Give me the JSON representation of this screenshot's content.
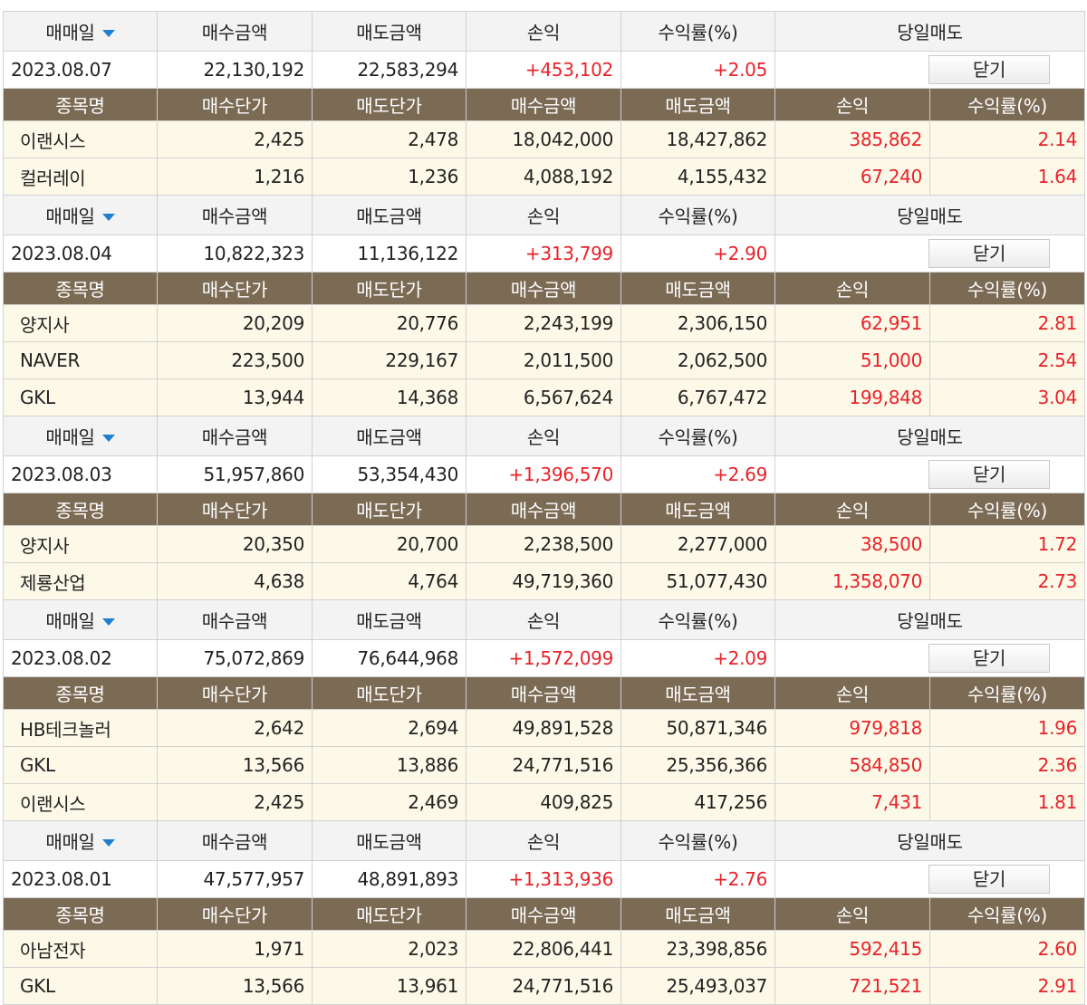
{
  "summary_headers": [
    "매매일",
    "매수금액",
    "매도금액",
    "손익",
    "수익률(%)",
    "당일매도"
  ],
  "detail_headers": [
    "종목명",
    "매수단가",
    "매도단가",
    "매수금액",
    "매도금액",
    "손익",
    "수익률(%)"
  ],
  "close_label": "닫기",
  "icons": {
    "sort": "sort-down-icon"
  },
  "colors": {
    "header_bg": "#7b6b55",
    "positive": "#e8222a",
    "detail_tint": "#fdf9e8",
    "sort_arrow": "#1e7fd0"
  },
  "groups": [
    {
      "date": "2023.08.07",
      "buy": "22,130,192",
      "sell": "22,583,294",
      "pnl": "+453,102",
      "rate": "+2.05",
      "items": [
        {
          "name": "이랜시스",
          "buy_price": "2,425",
          "sell_price": "2,478",
          "buy_amount": "18,042,000",
          "sell_amount": "18,427,862",
          "pnl": "385,862",
          "rate": "2.14"
        },
        {
          "name": "컬러레이",
          "buy_price": "1,216",
          "sell_price": "1,236",
          "buy_amount": "4,088,192",
          "sell_amount": "4,155,432",
          "pnl": "67,240",
          "rate": "1.64"
        }
      ]
    },
    {
      "date": "2023.08.04",
      "buy": "10,822,323",
      "sell": "11,136,122",
      "pnl": "+313,799",
      "rate": "+2.90",
      "items": [
        {
          "name": "양지사",
          "buy_price": "20,209",
          "sell_price": "20,776",
          "buy_amount": "2,243,199",
          "sell_amount": "2,306,150",
          "pnl": "62,951",
          "rate": "2.81"
        },
        {
          "name": "NAVER",
          "buy_price": "223,500",
          "sell_price": "229,167",
          "buy_amount": "2,011,500",
          "sell_amount": "2,062,500",
          "pnl": "51,000",
          "rate": "2.54"
        },
        {
          "name": "GKL",
          "buy_price": "13,944",
          "sell_price": "14,368",
          "buy_amount": "6,567,624",
          "sell_amount": "6,767,472",
          "pnl": "199,848",
          "rate": "3.04"
        }
      ]
    },
    {
      "date": "2023.08.03",
      "buy": "51,957,860",
      "sell": "53,354,430",
      "pnl": "+1,396,570",
      "rate": "+2.69",
      "items": [
        {
          "name": "양지사",
          "buy_price": "20,350",
          "sell_price": "20,700",
          "buy_amount": "2,238,500",
          "sell_amount": "2,277,000",
          "pnl": "38,500",
          "rate": "1.72"
        },
        {
          "name": "제룡산업",
          "buy_price": "4,638",
          "sell_price": "4,764",
          "buy_amount": "49,719,360",
          "sell_amount": "51,077,430",
          "pnl": "1,358,070",
          "rate": "2.73"
        }
      ]
    },
    {
      "date": "2023.08.02",
      "buy": "75,072,869",
      "sell": "76,644,968",
      "pnl": "+1,572,099",
      "rate": "+2.09",
      "items": [
        {
          "name": "HB테크놀러",
          "buy_price": "2,642",
          "sell_price": "2,694",
          "buy_amount": "49,891,528",
          "sell_amount": "50,871,346",
          "pnl": "979,818",
          "rate": "1.96"
        },
        {
          "name": "GKL",
          "buy_price": "13,566",
          "sell_price": "13,886",
          "buy_amount": "24,771,516",
          "sell_amount": "25,356,366",
          "pnl": "584,850",
          "rate": "2.36"
        },
        {
          "name": "이랜시스",
          "buy_price": "2,425",
          "sell_price": "2,469",
          "buy_amount": "409,825",
          "sell_amount": "417,256",
          "pnl": "7,431",
          "rate": "1.81"
        }
      ]
    },
    {
      "date": "2023.08.01",
      "buy": "47,577,957",
      "sell": "48,891,893",
      "pnl": "+1,313,936",
      "rate": "+2.76",
      "items": [
        {
          "name": "아남전자",
          "buy_price": "1,971",
          "sell_price": "2,023",
          "buy_amount": "22,806,441",
          "sell_amount": "23,398,856",
          "pnl": "592,415",
          "rate": "2.60"
        },
        {
          "name": "GKL",
          "buy_price": "13,566",
          "sell_price": "13,961",
          "buy_amount": "24,771,516",
          "sell_amount": "25,493,037",
          "pnl": "721,521",
          "rate": "2.91"
        }
      ]
    }
  ]
}
